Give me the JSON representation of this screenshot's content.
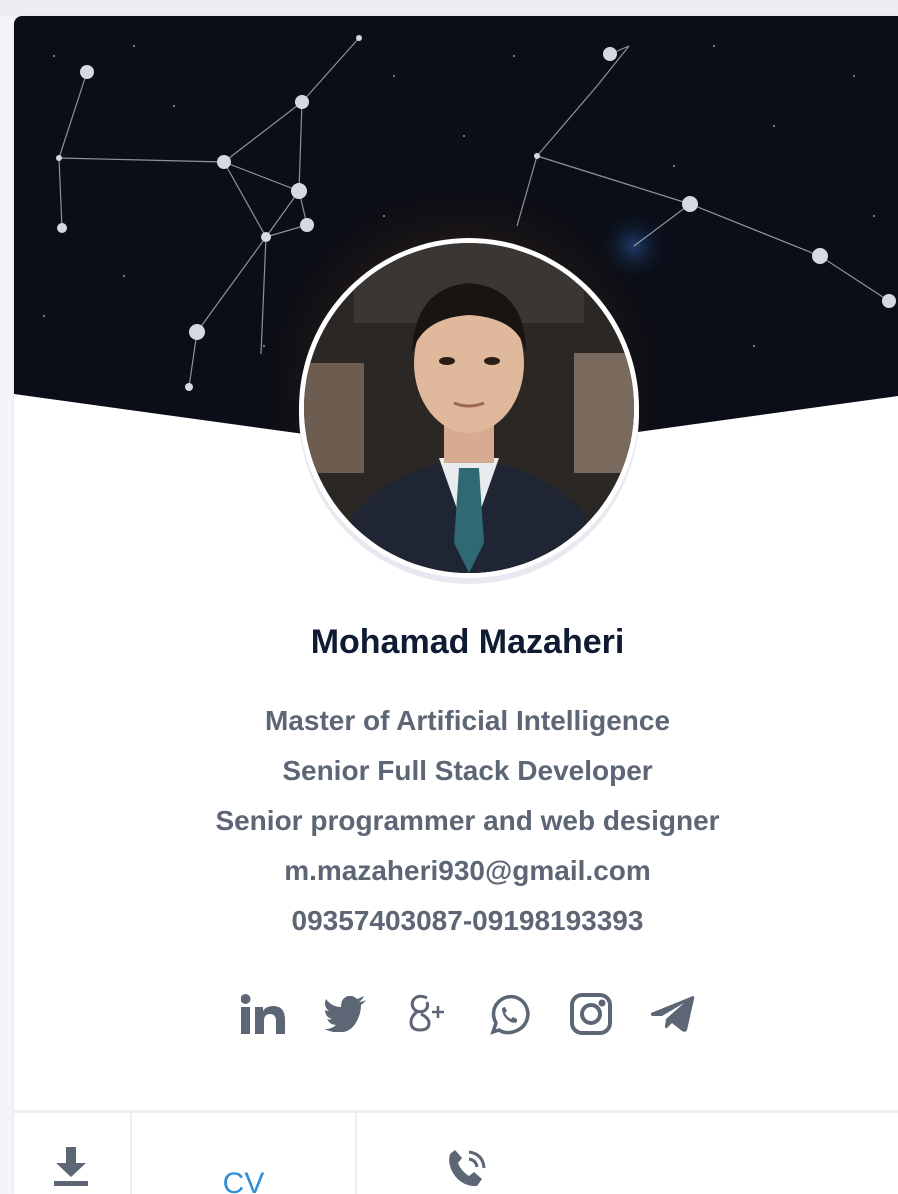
{
  "profile": {
    "name": "Mohamad Mazaheri",
    "lines": [
      "Master of Artificial Intelligence",
      "Senior Full Stack Developer",
      "Senior programmer and web designer",
      "m.mazaheri930@gmail.com",
      "09357403087-09198193393"
    ]
  },
  "social": [
    {
      "icon": "linkedin-icon"
    },
    {
      "icon": "twitter-icon"
    },
    {
      "icon": "google-plus-icon"
    },
    {
      "icon": "whatsapp-icon"
    },
    {
      "icon": "instagram-icon"
    },
    {
      "icon": "telegram-icon"
    }
  ],
  "actions": {
    "download_icon": "download-icon",
    "cv_label": "CV",
    "call_icon": "phone-call-icon"
  },
  "colors": {
    "name": "#0f1a33",
    "text": "#5d6675",
    "icon": "#5d6675",
    "link": "#2f8fd6",
    "cover": "#0b0e18"
  }
}
